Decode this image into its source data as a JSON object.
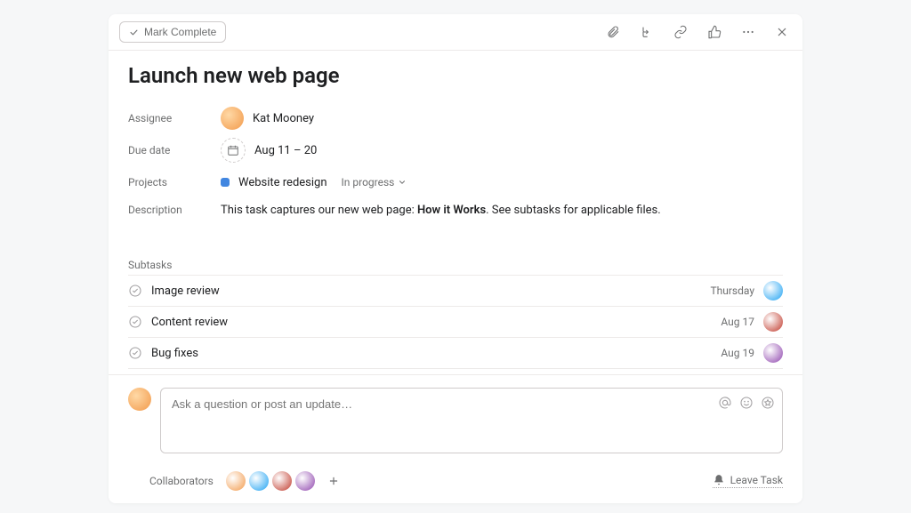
{
  "header": {
    "mark_complete_label": "Mark Complete"
  },
  "task": {
    "title": "Launch new web page",
    "assignee": {
      "label": "Assignee",
      "name": "Kat Mooney",
      "avatar_color": "#f2994a"
    },
    "due_date": {
      "label": "Due date",
      "value": "Aug 11 – 20"
    },
    "projects": {
      "label": "Projects",
      "name": "Website redesign",
      "dot_color": "#4186e0",
      "status": "In progress"
    },
    "description": {
      "label": "Description",
      "prefix": "This task captures our new web page: ",
      "bold": "How it Works",
      "suffix": ". See subtasks for applicable files."
    }
  },
  "subtasks": {
    "label": "Subtasks",
    "items": [
      {
        "title": "Image review",
        "date": "Thursday",
        "avatar_color": "#1da1f2"
      },
      {
        "title": "Content review",
        "date": "Aug 17",
        "avatar_color": "#c0392b"
      },
      {
        "title": "Bug fixes",
        "date": "Aug 19",
        "avatar_color": "#8e44ad"
      }
    ]
  },
  "comment": {
    "placeholder": "Ask a question or post an update…",
    "author_avatar_color": "#f2994a"
  },
  "footer": {
    "collaborators_label": "Collaborators",
    "collaborator_colors": [
      "#f2994a",
      "#1da1f2",
      "#c0392b",
      "#8e44ad"
    ],
    "leave_task_label": "Leave Task"
  }
}
